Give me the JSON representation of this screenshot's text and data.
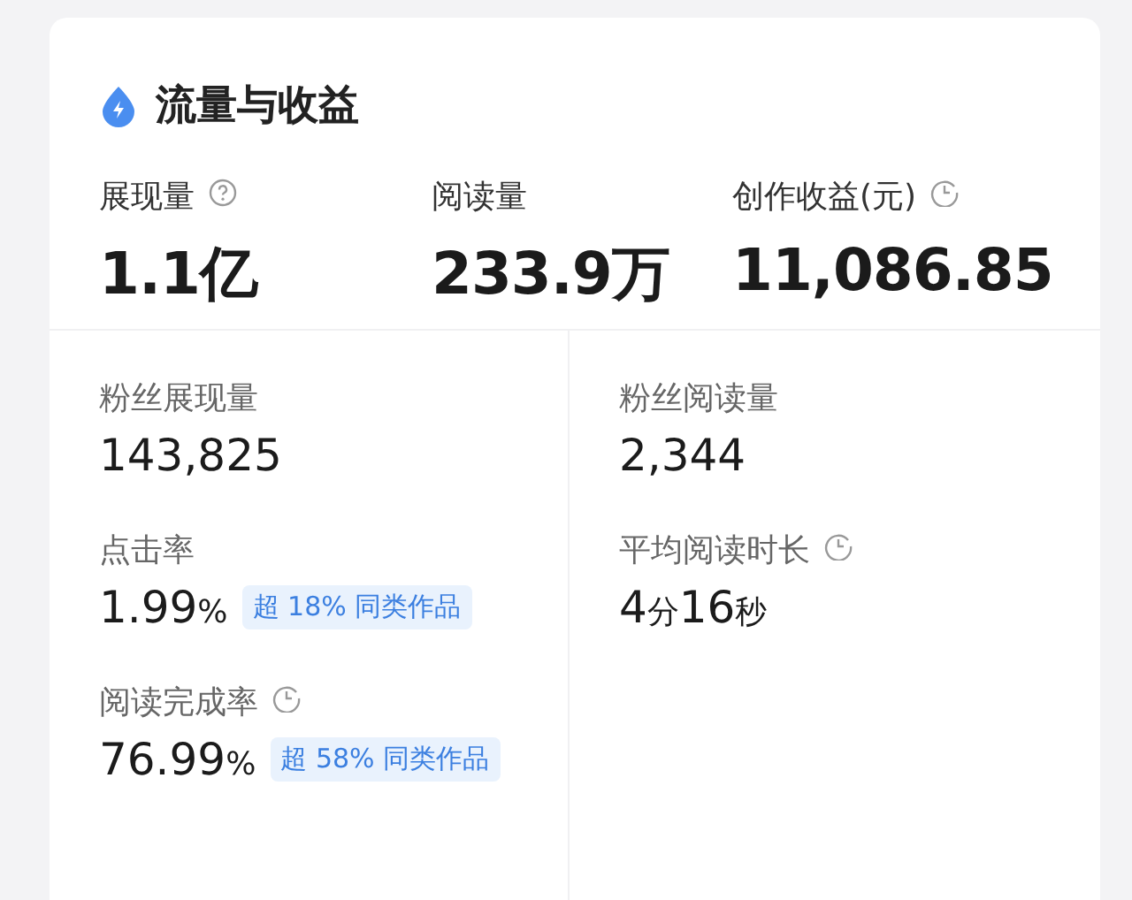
{
  "card": {
    "title": "流量与收益",
    "summary": [
      {
        "label": "展现量",
        "kind": "help",
        "value": "1.1亿"
      },
      {
        "label": "阅读量",
        "kind": "plain",
        "value": "233.9万"
      },
      {
        "label": "创作收益(元)",
        "kind": "clock",
        "value": "11,086.85"
      }
    ],
    "columns": [
      [
        {
          "label": "粉丝展现量",
          "kind": "plain",
          "value": [
            {
              "text": "143,825",
              "kind": "num"
            }
          ]
        },
        {
          "label": "点击率",
          "kind": "plain",
          "value": [
            {
              "text": "1.99",
              "kind": "num"
            },
            {
              "text": "%",
              "kind": "unit"
            }
          ],
          "badge": "超 18% 同类作品"
        },
        {
          "label": "阅读完成率",
          "kind": "clock",
          "value": [
            {
              "text": "76.99",
              "kind": "num"
            },
            {
              "text": "%",
              "kind": "unit"
            }
          ],
          "badge": "超 58% 同类作品"
        }
      ],
      [
        {
          "label": "粉丝阅读量",
          "kind": "plain",
          "value": [
            {
              "text": "2,344",
              "kind": "num"
            }
          ]
        },
        {
          "label": "平均阅读时长",
          "kind": "clock",
          "value": [
            {
              "text": "4",
              "kind": "num"
            },
            {
              "text": "分",
              "kind": "unit"
            },
            {
              "text": "16",
              "kind": "num"
            },
            {
              "text": "秒",
              "kind": "unit"
            }
          ]
        }
      ]
    ]
  }
}
